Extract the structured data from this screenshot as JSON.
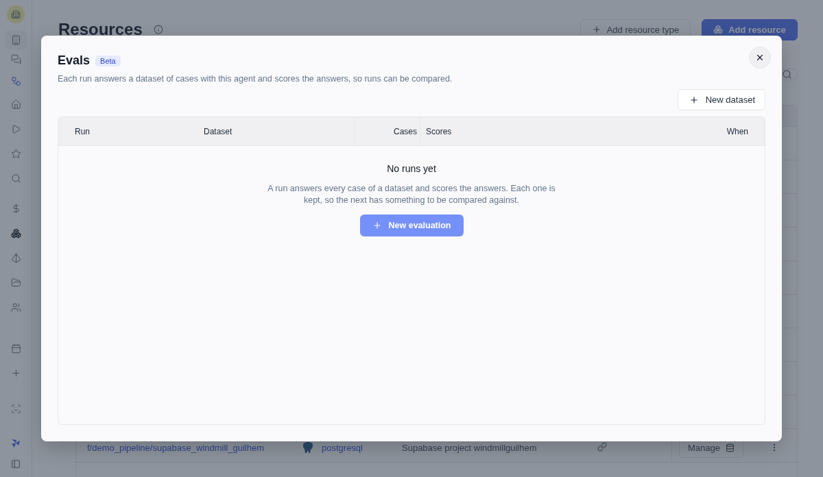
{
  "sidebar": {
    "items": [
      {
        "selected": false
      },
      {
        "selected": false
      },
      {
        "selected": false
      },
      {
        "selected": false
      },
      {
        "selected": false
      },
      {
        "selected": false
      },
      {
        "selected": false
      },
      {
        "selected": false
      },
      {
        "selected": true
      },
      {
        "selected": false
      },
      {
        "selected": false
      },
      {
        "selected": false
      },
      {
        "selected": false
      },
      {
        "selected": false
      },
      {
        "selected": false
      }
    ]
  },
  "page": {
    "title": "Resources",
    "actions": [
      {
        "label": "Add resource type",
        "kind": "secondary"
      },
      {
        "label": "Add resource",
        "kind": "primary"
      }
    ],
    "table": {
      "rows": [
        {
          "path": "f/demo_pipeline/supabase_windmill_guilhem",
          "type": "postgresql",
          "description": "Supabase project windmillguilhem",
          "linked": true,
          "action": "Manage"
        }
      ]
    }
  },
  "modal": {
    "title": "Evals",
    "badge": "Beta",
    "description": "Each run answers a dataset of cases with this agent and scores the answers, so runs can be compared.",
    "new_dataset": "New dataset",
    "table": {
      "columns": [
        "Run",
        "Dataset",
        "Cases",
        "Scores",
        "When"
      ]
    },
    "empty": {
      "title": "No runs yet",
      "text": "A run answers every case of a dataset and scores the answers. Each one is kept, so the next has something to be compared against.",
      "action": "New evaluation"
    }
  }
}
